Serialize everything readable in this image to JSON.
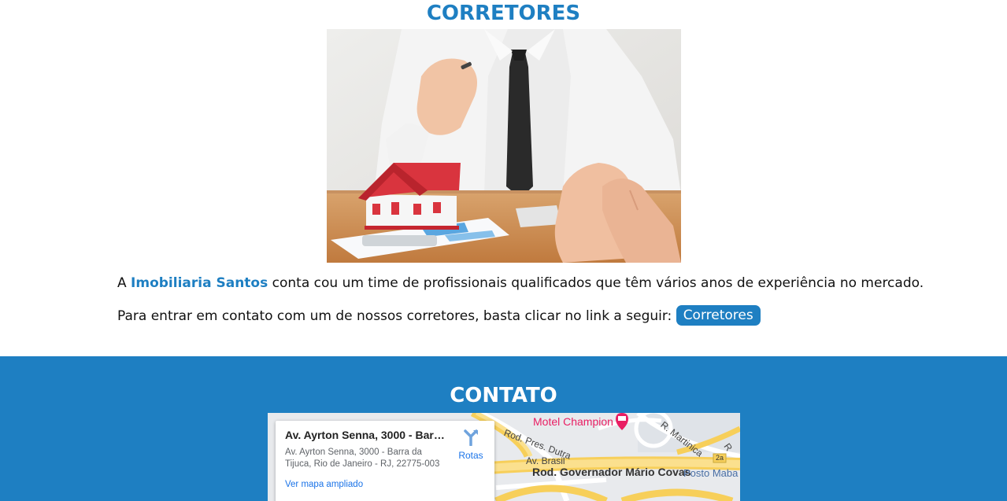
{
  "corretores": {
    "title": "CORRETORES",
    "image_alt": "Corretor com maquete de casa",
    "paragraph1_prefix": "A ",
    "brand_name": "Imobiliaria Santos",
    "paragraph1_suffix": " conta cou um time de profissionais qualificados que têm vários anos de experiência no mercado.",
    "paragraph2": "Para entrar em contato com um de nossos corretores, basta clicar no link a seguir: ",
    "button_label": "Corretores"
  },
  "contato": {
    "title": "CONTATO",
    "map": {
      "place_title": "Av. Ayrton Senna, 3000 - Barra...",
      "address": "Av. Ayrton Senna, 3000 - Barra da Tijuca, Rio de Janeiro - RJ, 22775-003",
      "directions_label": "Rotas",
      "larger_map_link": "Ver mapa ampliado",
      "labels": {
        "motel": "Motel Champion",
        "rod_pres_dutra": "Rod. Pres. Dutra",
        "r_martinica": "R. Martinica",
        "av_brasil": "Av. Brasil",
        "rod_mario_covas": "Rod. Governador Mário Covas",
        "posto": "Posto Maba",
        "exit": "2a",
        "r": "R"
      }
    }
  },
  "colors": {
    "accent": "#1e7fc2",
    "map_link": "#1a73e8",
    "map_poi": "#e91e63",
    "road_major": "#f9d66b"
  }
}
